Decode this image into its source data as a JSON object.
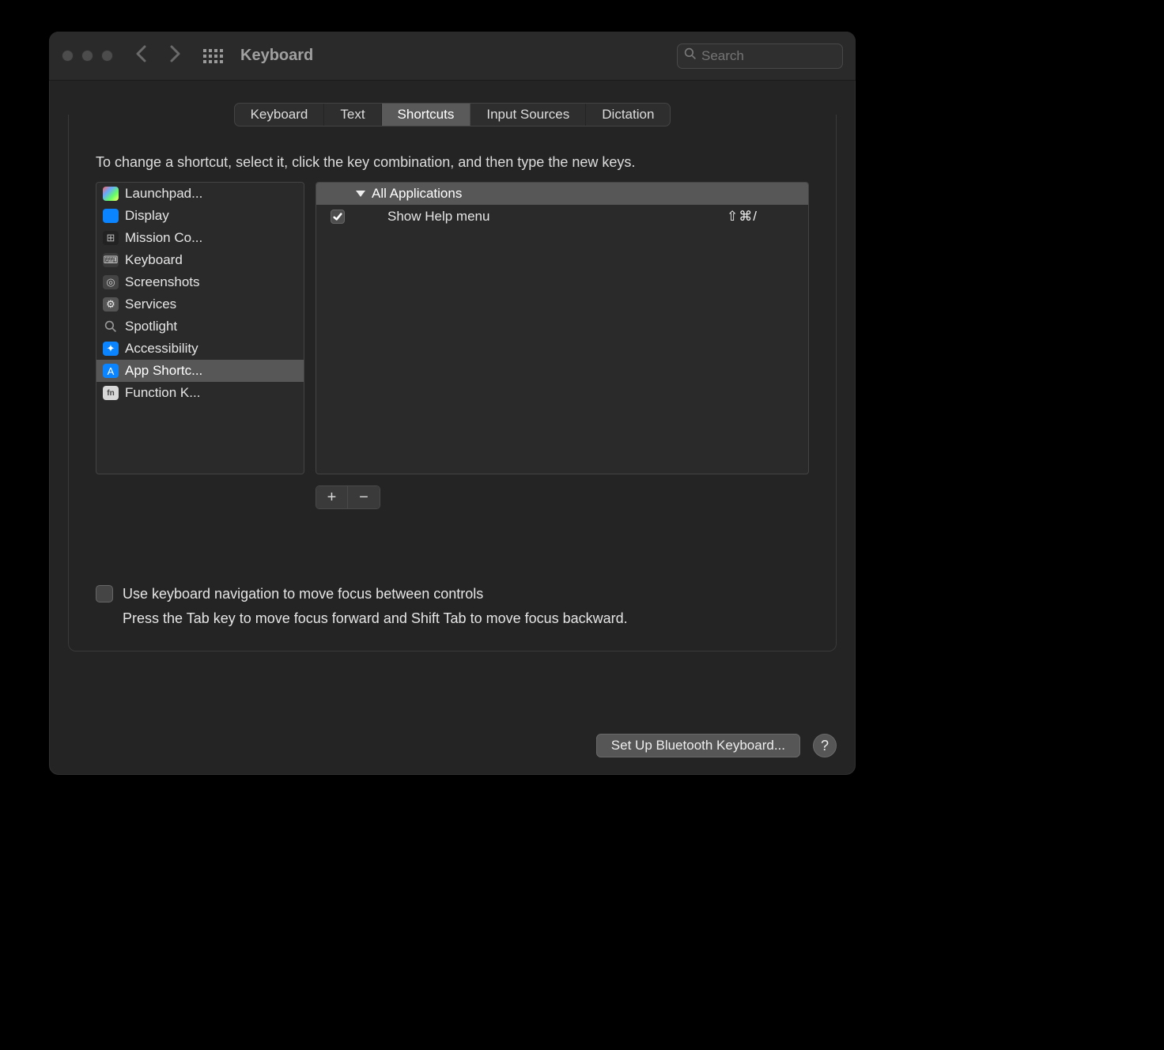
{
  "window": {
    "title": "Keyboard"
  },
  "search": {
    "placeholder": "Search",
    "value": ""
  },
  "tabs": [
    {
      "label": "Keyboard",
      "active": false
    },
    {
      "label": "Text",
      "active": false
    },
    {
      "label": "Shortcuts",
      "active": true
    },
    {
      "label": "Input Sources",
      "active": false
    },
    {
      "label": "Dictation",
      "active": false
    }
  ],
  "instruction": "To change a shortcut, select it, click the key combination, and then type the new keys.",
  "categories": [
    {
      "label": "Launchpad...",
      "icon": "launchpad",
      "selected": false
    },
    {
      "label": "Display",
      "icon": "display",
      "selected": false
    },
    {
      "label": "Mission Co...",
      "icon": "mission",
      "selected": false
    },
    {
      "label": "Keyboard",
      "icon": "keyboard",
      "selected": false
    },
    {
      "label": "Screenshots",
      "icon": "screenshots",
      "selected": false
    },
    {
      "label": "Services",
      "icon": "services",
      "selected": false
    },
    {
      "label": "Spotlight",
      "icon": "spotlight",
      "selected": false
    },
    {
      "label": "Accessibility",
      "icon": "accessibility",
      "selected": false
    },
    {
      "label": "App Shortc...",
      "icon": "appshortcuts",
      "selected": true
    },
    {
      "label": "Function K...",
      "icon": "function",
      "selected": false
    }
  ],
  "shortcuts": {
    "group": "All Applications",
    "items": [
      {
        "enabled": true,
        "label": "Show Help menu",
        "keys": "⇧⌘/"
      }
    ]
  },
  "addremove": {
    "add": "+",
    "remove": "−"
  },
  "options": {
    "kb_nav": {
      "checked": false,
      "label": "Use keyboard navigation to move focus between controls"
    },
    "kb_nav_sub": "Press the Tab key to move focus forward and Shift Tab to move focus backward."
  },
  "footer": {
    "bluetooth": "Set Up Bluetooth Keyboard...",
    "help": "?"
  }
}
